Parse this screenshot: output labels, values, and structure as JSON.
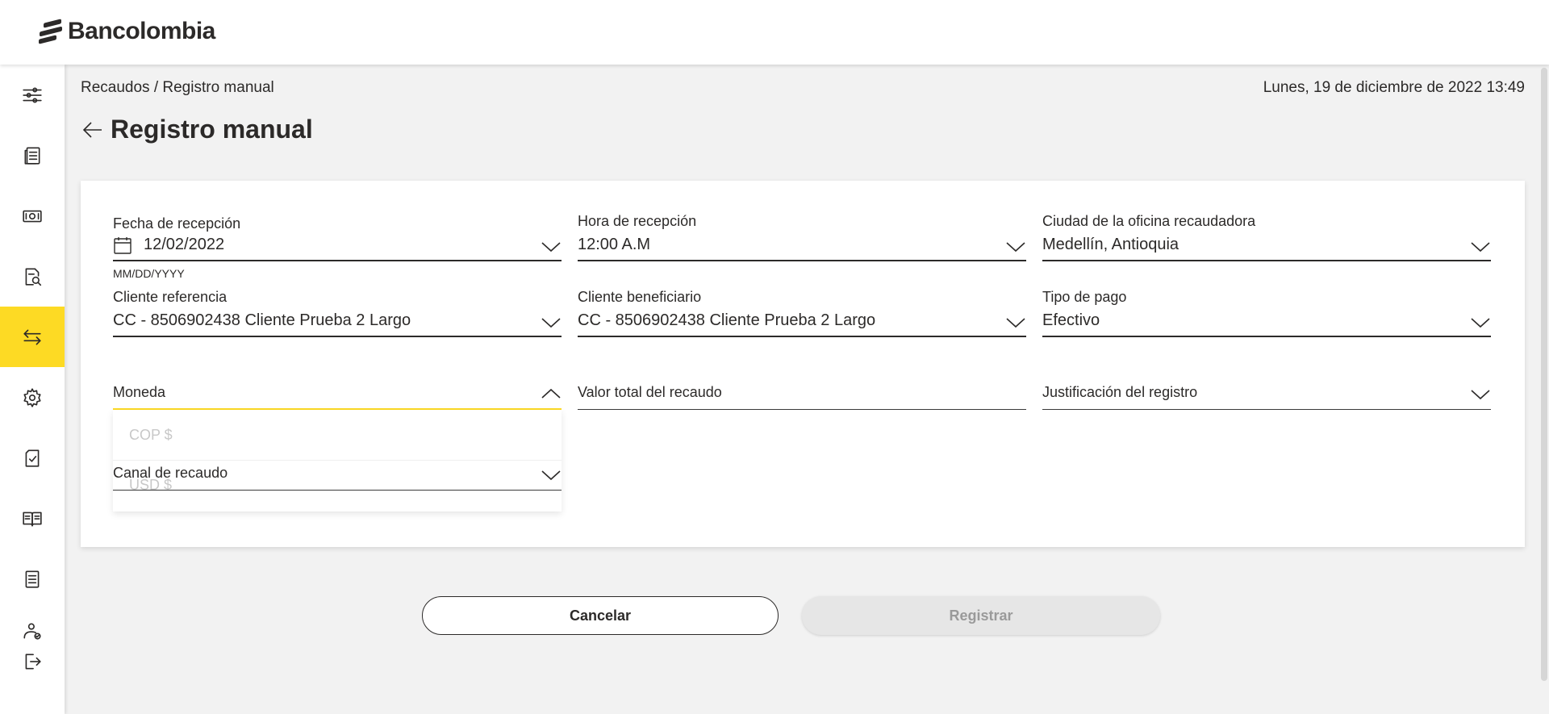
{
  "header": {
    "logo_text": "Bancolombia"
  },
  "sidebar": {
    "items": [
      {
        "icon": "sliders-icon",
        "active": false
      },
      {
        "icon": "document-list-icon",
        "active": false
      },
      {
        "icon": "cash-icon",
        "active": false
      },
      {
        "icon": "document-search-icon",
        "active": false
      },
      {
        "icon": "transfer-arrows-icon",
        "active": true
      },
      {
        "icon": "gear-icon",
        "active": false
      },
      {
        "icon": "document-check-icon",
        "active": false
      },
      {
        "icon": "book-icon",
        "active": false
      },
      {
        "icon": "notebook-icon",
        "active": false
      },
      {
        "icon": "user-settings-icon",
        "active": false
      },
      {
        "icon": "logout-icon",
        "active": false
      }
    ],
    "active_color": "#fdda24"
  },
  "breadcrumb": "Recaudos / Registro manual",
  "datetime": "Lunes, 19 de diciembre de 2022 13:49",
  "page_title": "Registro manual",
  "form": {
    "fecha": {
      "label": "Fecha de recepción",
      "value": "12/02/2022",
      "hint": "MM/DD/YYYY"
    },
    "hora": {
      "label": "Hora de recepción",
      "value": "12:00 A.M"
    },
    "ciudad": {
      "label": "Ciudad de la oficina recaudadora",
      "value": "Medellín, Antioquia"
    },
    "cliente_ref": {
      "label": "Cliente referencia",
      "value": "CC - 8506902438  Cliente Prueba 2 Largo"
    },
    "cliente_ben": {
      "label": "Cliente beneficiario",
      "value": "CC - 8506902438  Cliente Prueba 2 Largo"
    },
    "tipo_pago": {
      "label": "Tipo de pago",
      "value": "Efectivo"
    },
    "moneda": {
      "label": "Moneda",
      "options": [
        "COP $",
        "USD $"
      ]
    },
    "valor_total": {
      "label": "Valor total del recaudo"
    },
    "justificacion": {
      "label": "Justificación del registro"
    },
    "canal": {
      "label": "Canal de recaudo"
    }
  },
  "buttons": {
    "cancel": "Cancelar",
    "register": "Registrar"
  }
}
